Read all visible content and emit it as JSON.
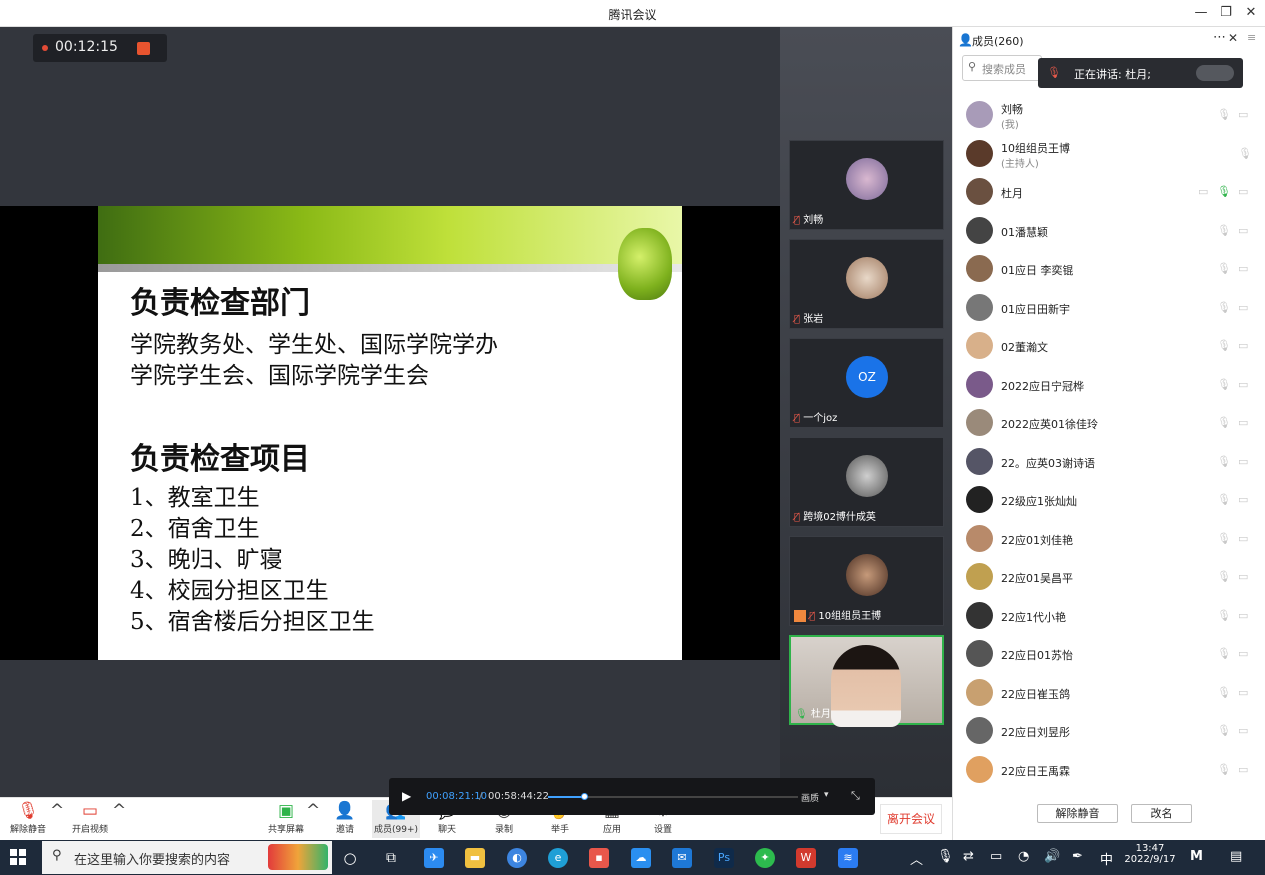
{
  "window": {
    "title": "腾讯会议"
  },
  "recording": {
    "elapsed": "00:12:15"
  },
  "slide": {
    "heading1": "负责检查部门",
    "line1": "学院教务处、学生处、国际学院学办",
    "line2": "学院学生会、国际学院学生会",
    "heading2": "负责检查项目",
    "items": [
      "1、教室卫生",
      "2、宿舍卫生",
      "3、晚归、旷寝",
      "4、校园分担区卫生",
      "5、宿舍楼后分担区卫生"
    ]
  },
  "video_tiles": [
    {
      "name": "刘畅"
    },
    {
      "name": "张岩"
    },
    {
      "name": "一个joz",
      "initials": "OZ"
    },
    {
      "name": "跨境02博什成英"
    },
    {
      "name": "10组组员王博"
    },
    {
      "name": "杜月"
    }
  ],
  "members_panel": {
    "title": "成员(260)",
    "search_placeholder": "搜索成员",
    "speaking_text": "正在讲话: 杜月;",
    "members": [
      {
        "name": "刘畅",
        "sub": "(我)"
      },
      {
        "name": "10组组员王博",
        "sub": "(主持人)"
      },
      {
        "name": "杜月",
        "sub": ""
      },
      {
        "name": "01潘慧颖",
        "sub": ""
      },
      {
        "name": "01应日 李奕锟",
        "sub": ""
      },
      {
        "name": "01应日田新宇",
        "sub": ""
      },
      {
        "name": "02董瀚文",
        "sub": ""
      },
      {
        "name": "2022应日宁冠桦",
        "sub": ""
      },
      {
        "name": "2022应英01徐佳玲",
        "sub": ""
      },
      {
        "name": "22。应英03谢诗语",
        "sub": ""
      },
      {
        "name": "22级应1张灿灿",
        "sub": ""
      },
      {
        "name": "22应01刘佳艳",
        "sub": ""
      },
      {
        "name": "22应01吴昌平",
        "sub": ""
      },
      {
        "name": "22应1代小艳",
        "sub": ""
      },
      {
        "name": "22应日01苏怡",
        "sub": ""
      },
      {
        "name": "22应日崔玉鸽",
        "sub": ""
      },
      {
        "name": "22应日刘昱彤",
        "sub": ""
      },
      {
        "name": "22应日王禹霖",
        "sub": ""
      }
    ],
    "unmute_all": "解除静音",
    "rename": "改名"
  },
  "toolbar": {
    "unmute": "解除静音",
    "video": "开启视频",
    "share": "共享屏幕",
    "invite": "邀请",
    "members": "成员(99+)",
    "chat": "聊天",
    "record": "录制",
    "raise_hand": "举手",
    "apps": "应用",
    "settings": "设置",
    "leave": "离开会议"
  },
  "player": {
    "current": "00:08:21:10",
    "separator": "/",
    "total": "00:58:44:22",
    "quality": "画质",
    "progress": 0.142
  },
  "taskbar": {
    "search_placeholder": "在这里输入你要搜索的内容",
    "ime": "中",
    "time": "13:47",
    "date": "2022/9/17"
  },
  "colors": {
    "accent_red": "#e03c2f",
    "speaking_green": "#2fb34a",
    "avatar_blue": "#1a73e8"
  }
}
